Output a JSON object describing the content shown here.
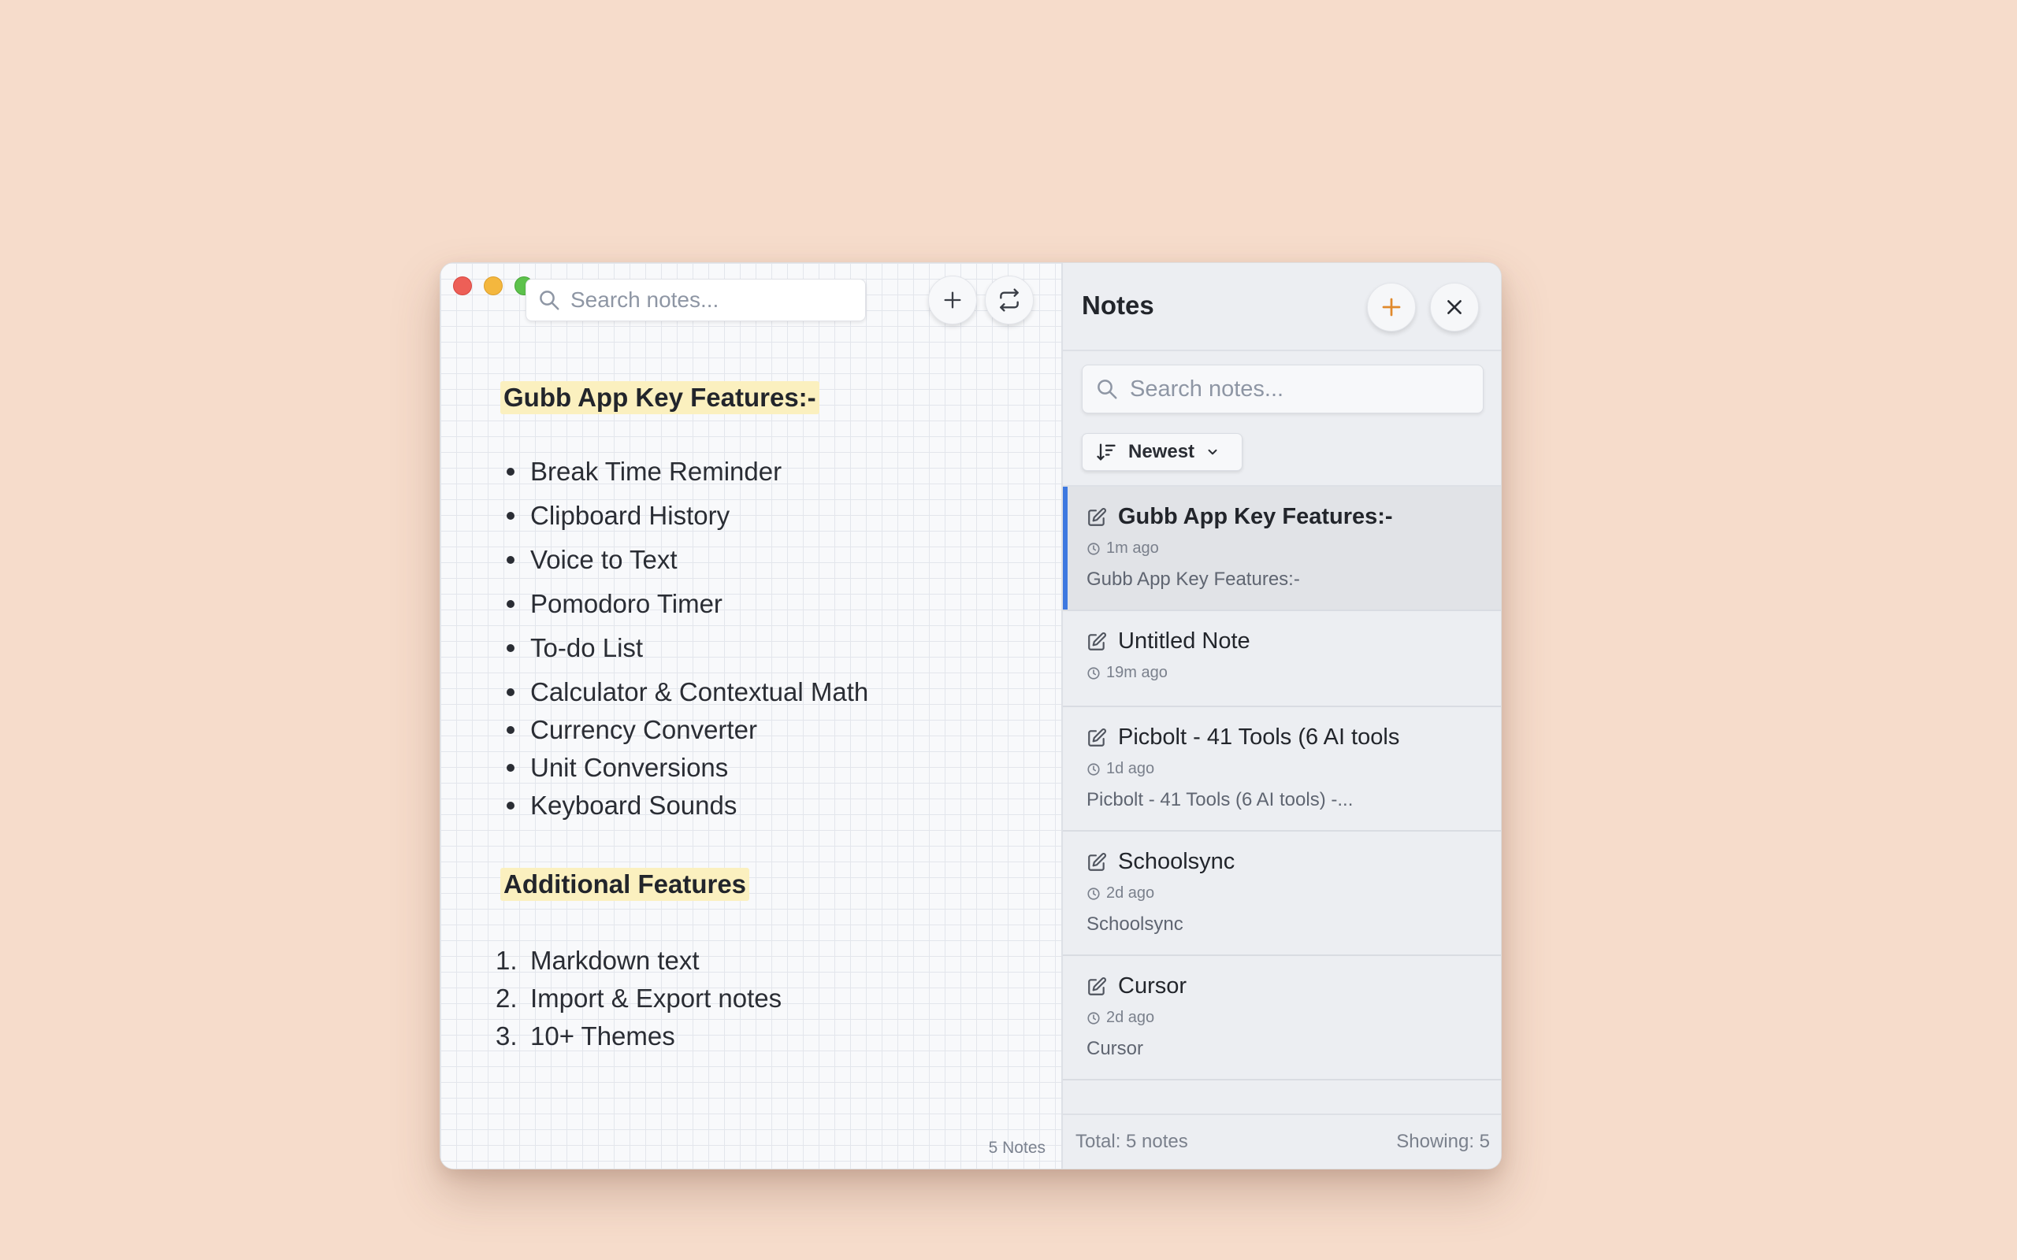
{
  "editor": {
    "search_placeholder": "Search notes...",
    "heading1": "Gubb App Key Features:-",
    "features": [
      "Break Time Reminder",
      "Clipboard History",
      "Voice to Text",
      "Pomodoro Timer",
      "To-do List",
      "Calculator & Contextual Math",
      "Currency Converter",
      "Unit Conversions",
      "Keyboard Sounds"
    ],
    "heading2": "Additional Features",
    "additional": [
      {
        "num": "1.",
        "text": "Markdown text"
      },
      {
        "num": "2.",
        "text": "Import & Export notes"
      },
      {
        "num": "3.",
        "text": "10+ Themes"
      }
    ],
    "notes_count": "5 Notes"
  },
  "panel": {
    "title": "Notes",
    "search_placeholder": "Search notes...",
    "sort_label": "Newest",
    "notes": [
      {
        "title": "Gubb App Key Features:-",
        "time": "1m ago",
        "preview": "Gubb App Key Features:-"
      },
      {
        "title": "Untitled Note",
        "time": "19m ago",
        "preview": ""
      },
      {
        "title": "Picbolt - 41 Tools (6 AI tools",
        "time": "1d ago",
        "preview": "Picbolt - 41 Tools (6 AI tools) -..."
      },
      {
        "title": "Schoolsync",
        "time": "2d ago",
        "preview": "Schoolsync"
      },
      {
        "title": "Cursor",
        "time": "2d ago",
        "preview": "Cursor"
      }
    ],
    "footer_total": "Total: 5 notes",
    "footer_showing": "Showing: 5"
  },
  "colors": {
    "background": "#f6dccb",
    "accent_orange": "#e0892c",
    "active_bar": "#3d78e0",
    "highlight": "#fbf0bf"
  },
  "icons": [
    "search-icon",
    "plus-icon",
    "sync-icon",
    "close-icon",
    "sort-icon",
    "chevron-down-icon",
    "edit-icon",
    "clock-icon"
  ]
}
